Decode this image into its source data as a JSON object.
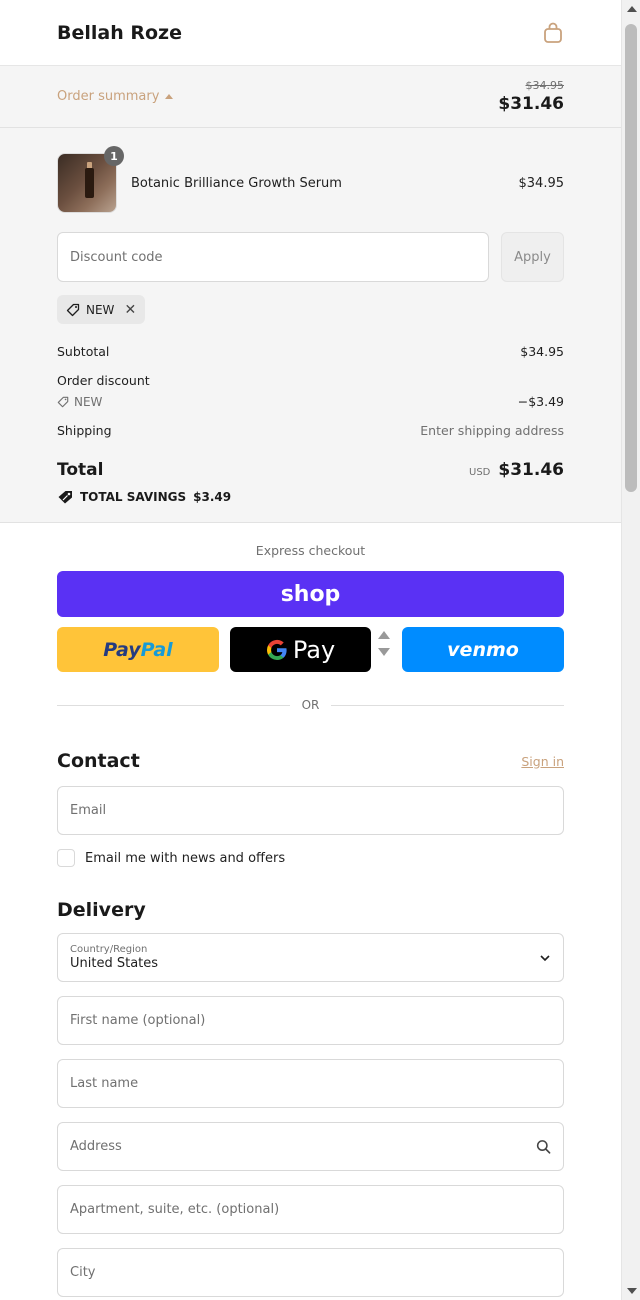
{
  "header": {
    "brand": "Bellah Roze",
    "cart_icon": "shopping-bag-icon"
  },
  "summary_toggle": {
    "label": "Order summary",
    "old_price": "$34.95",
    "price": "$31.46"
  },
  "order": {
    "product": {
      "name": "Botanic Brilliance Growth Serum",
      "price": "$34.95",
      "quantity": "1"
    },
    "discount_placeholder": "Discount code",
    "apply_label": "Apply",
    "applied_code": "NEW",
    "subtotal_label": "Subtotal",
    "subtotal_value": "$34.95",
    "order_discount_label": "Order discount",
    "discount_code": "NEW",
    "discount_value": "−$3.49",
    "shipping_label": "Shipping",
    "shipping_value": "Enter shipping address",
    "total_label": "Total",
    "currency": "USD",
    "total_value": "$31.46",
    "savings_label": "TOTAL SAVINGS",
    "savings_value": "$3.49"
  },
  "express": {
    "title": "Express checkout",
    "shop_label": "shop",
    "paypal_a": "Pay",
    "paypal_b": "Pal",
    "gpay_g": "G",
    "gpay_label": "Pay",
    "venmo_label": "venmo",
    "or_label": "OR"
  },
  "contact": {
    "title": "Contact",
    "sign_in": "Sign in",
    "email_placeholder": "Email",
    "newsletter_label": "Email me with news and offers"
  },
  "delivery": {
    "title": "Delivery",
    "country_label": "Country/Region",
    "country_value": "United States",
    "first_name_placeholder": "First name (optional)",
    "last_name_placeholder": "Last name",
    "address_placeholder": "Address",
    "apartment_placeholder": "Apartment, suite, etc. (optional)",
    "city_placeholder": "City"
  },
  "colors": {
    "accent": "#c9a27d",
    "shop_pay": "#5a31f4",
    "paypal": "#ffc439",
    "venmo": "#008cff"
  }
}
